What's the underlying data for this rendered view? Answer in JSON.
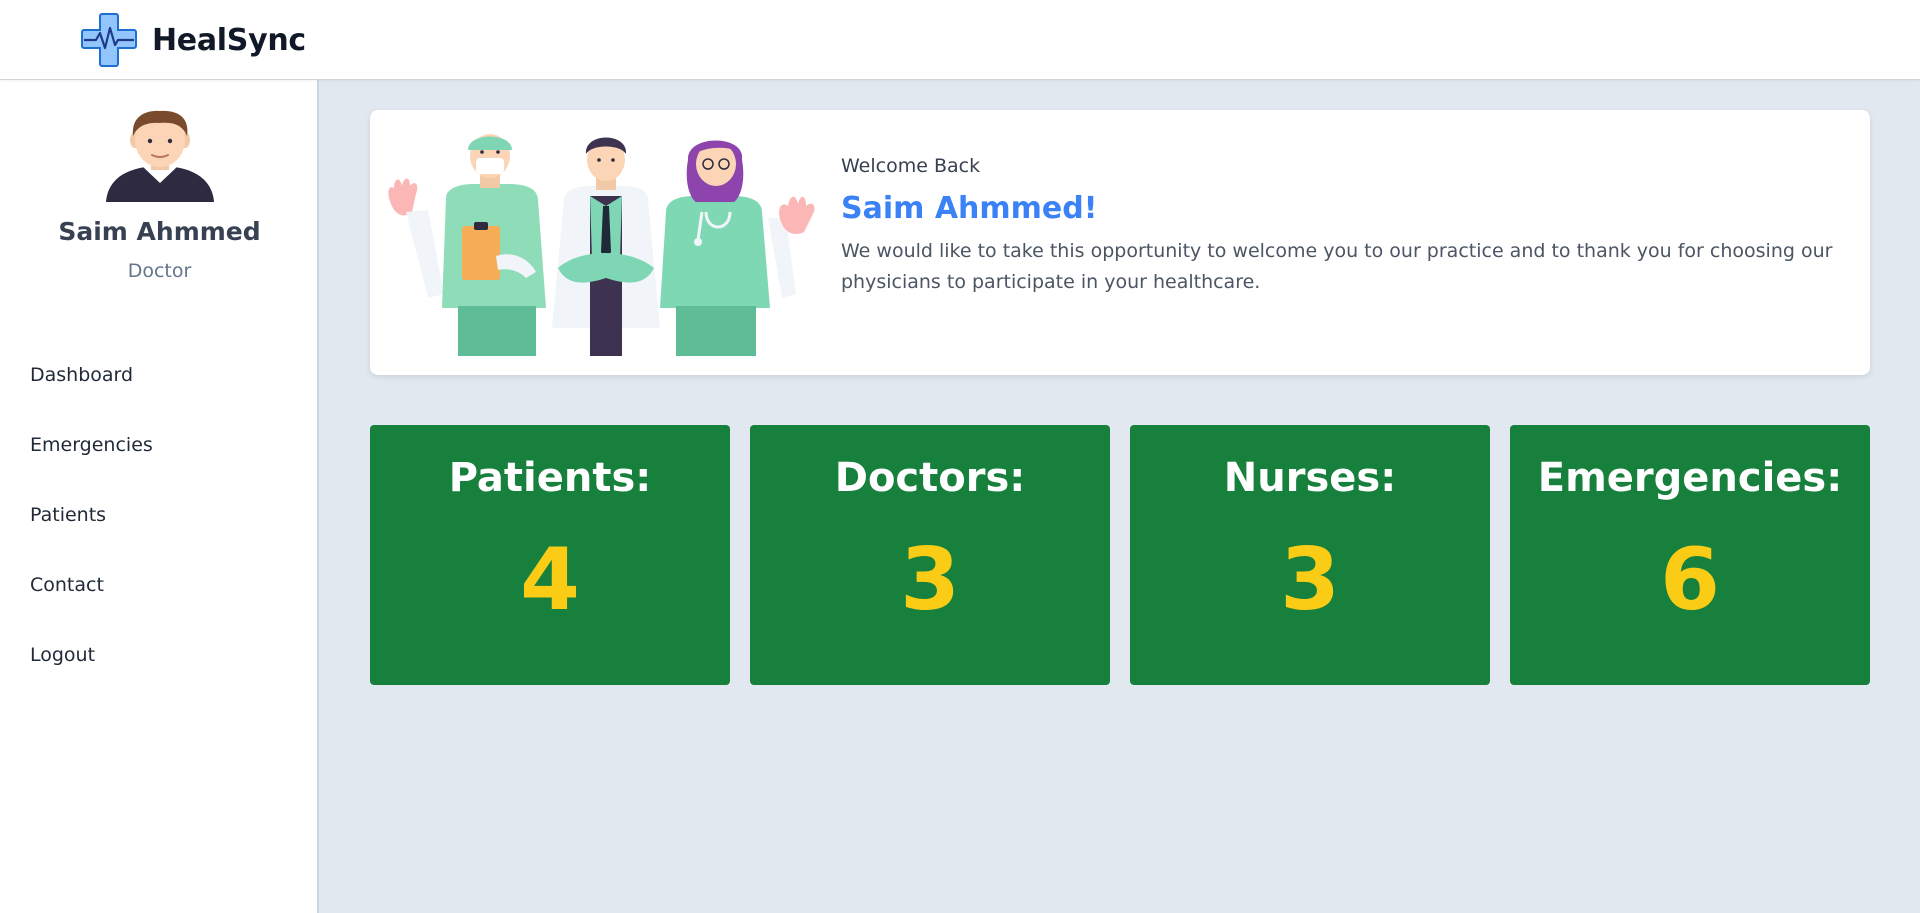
{
  "app": {
    "name": "HealSync",
    "logo_icon": "medical-cross-heartbeat-icon"
  },
  "user": {
    "name": "Saim Ahmmed",
    "role": "Doctor",
    "avatar_icon": "male-avatar-icon"
  },
  "sidebar": {
    "items": [
      {
        "label": "Dashboard"
      },
      {
        "label": "Emergencies"
      },
      {
        "label": "Patients"
      },
      {
        "label": "Contact"
      },
      {
        "label": "Logout"
      }
    ]
  },
  "welcome": {
    "kicker": "Welcome Back",
    "name": "Saim Ahmmed!",
    "message": "We would like to take this opportunity to welcome you to our practice and to thank you for choosing our physicians to participate in your healthcare.",
    "illustration": "medical-staff-waving-illustration"
  },
  "stats": [
    {
      "label": "Patients:",
      "value": "4"
    },
    {
      "label": "Doctors:",
      "value": "3"
    },
    {
      "label": "Nurses:",
      "value": "3"
    },
    {
      "label": "Emergencies:",
      "value": "6"
    }
  ],
  "colors": {
    "brand_blue": "#3b82f6",
    "stat_card_bg": "#16803c",
    "stat_value": "#facc15",
    "page_bg": "#e2e8f0"
  }
}
